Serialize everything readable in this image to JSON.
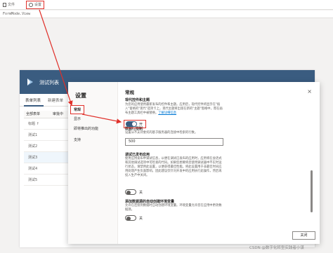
{
  "toolbar": {
    "file_label": "文件",
    "settings_label": "设置"
  },
  "formula_bar": {
    "text": "FormMode.View"
  },
  "app": {
    "title": "测试列表",
    "tabs": [
      "表单列表",
      "新建表单"
    ],
    "table_headers": [
      "全部表单",
      "审批中"
    ],
    "rows": [
      "标题 ↑",
      "测试1",
      "测试2",
      "测试3",
      "测试4",
      "测试5"
    ]
  },
  "dialog": {
    "title": "设置",
    "nav_items": [
      "常规",
      "显示",
      "即将推出的功能",
      "支持"
    ],
    "section_title": "常规",
    "close_icon": "×",
    "sections": {
      "modern_controls": {
        "title": "现代控件和主题",
        "description": "为您的应用使用最新发布的控件和主题。应用后，现代控件将显示在\"插入\"窗格的\"现代\"选项卡上，现代主题将出现在新的\"主题\"窗格中，而在画布主题工具栏中被替换。",
        "link": "了解详细信息",
        "toggle_state": "开",
        "toggle_on": true
      },
      "data_row_limit": {
        "title": "数据行限制",
        "description": "设置从不支持委托的基于服务器的连接中检索的行数。",
        "value": "500"
      },
      "debug_published_app": {
        "title": "调试已发布应用",
        "description": "使用应用发布中调试信息，以便在调试已发布的应用时，应用将在会话式和其他调试选项中可检查的代码。如果您想要将您使用调试器中不实时运行状态，请禁用此设置，以便获得最佳性能。将此设置用于非最佳时间应用处理产生负面影响，因此建议仅针对开发中的应用执行此操作，然后再投入生产中关闭。",
        "toggle_state": "关",
        "toggle_on": false
      },
      "auto_env_variables": {
        "title": "添加数据源的自动创建环境变量",
        "description": "允许在连接到数据时自动创建环境变量。环境变量允许您在应用中更改数据源。",
        "toggle_state": "关",
        "toggle_on": false
      }
    },
    "close_button": "关闭"
  },
  "watermark": "CSDN @数字化转型实践者小谋",
  "colors": {
    "accent": "#3a5c80",
    "annotation_red": "#e0302a",
    "link": "#0078d4"
  }
}
